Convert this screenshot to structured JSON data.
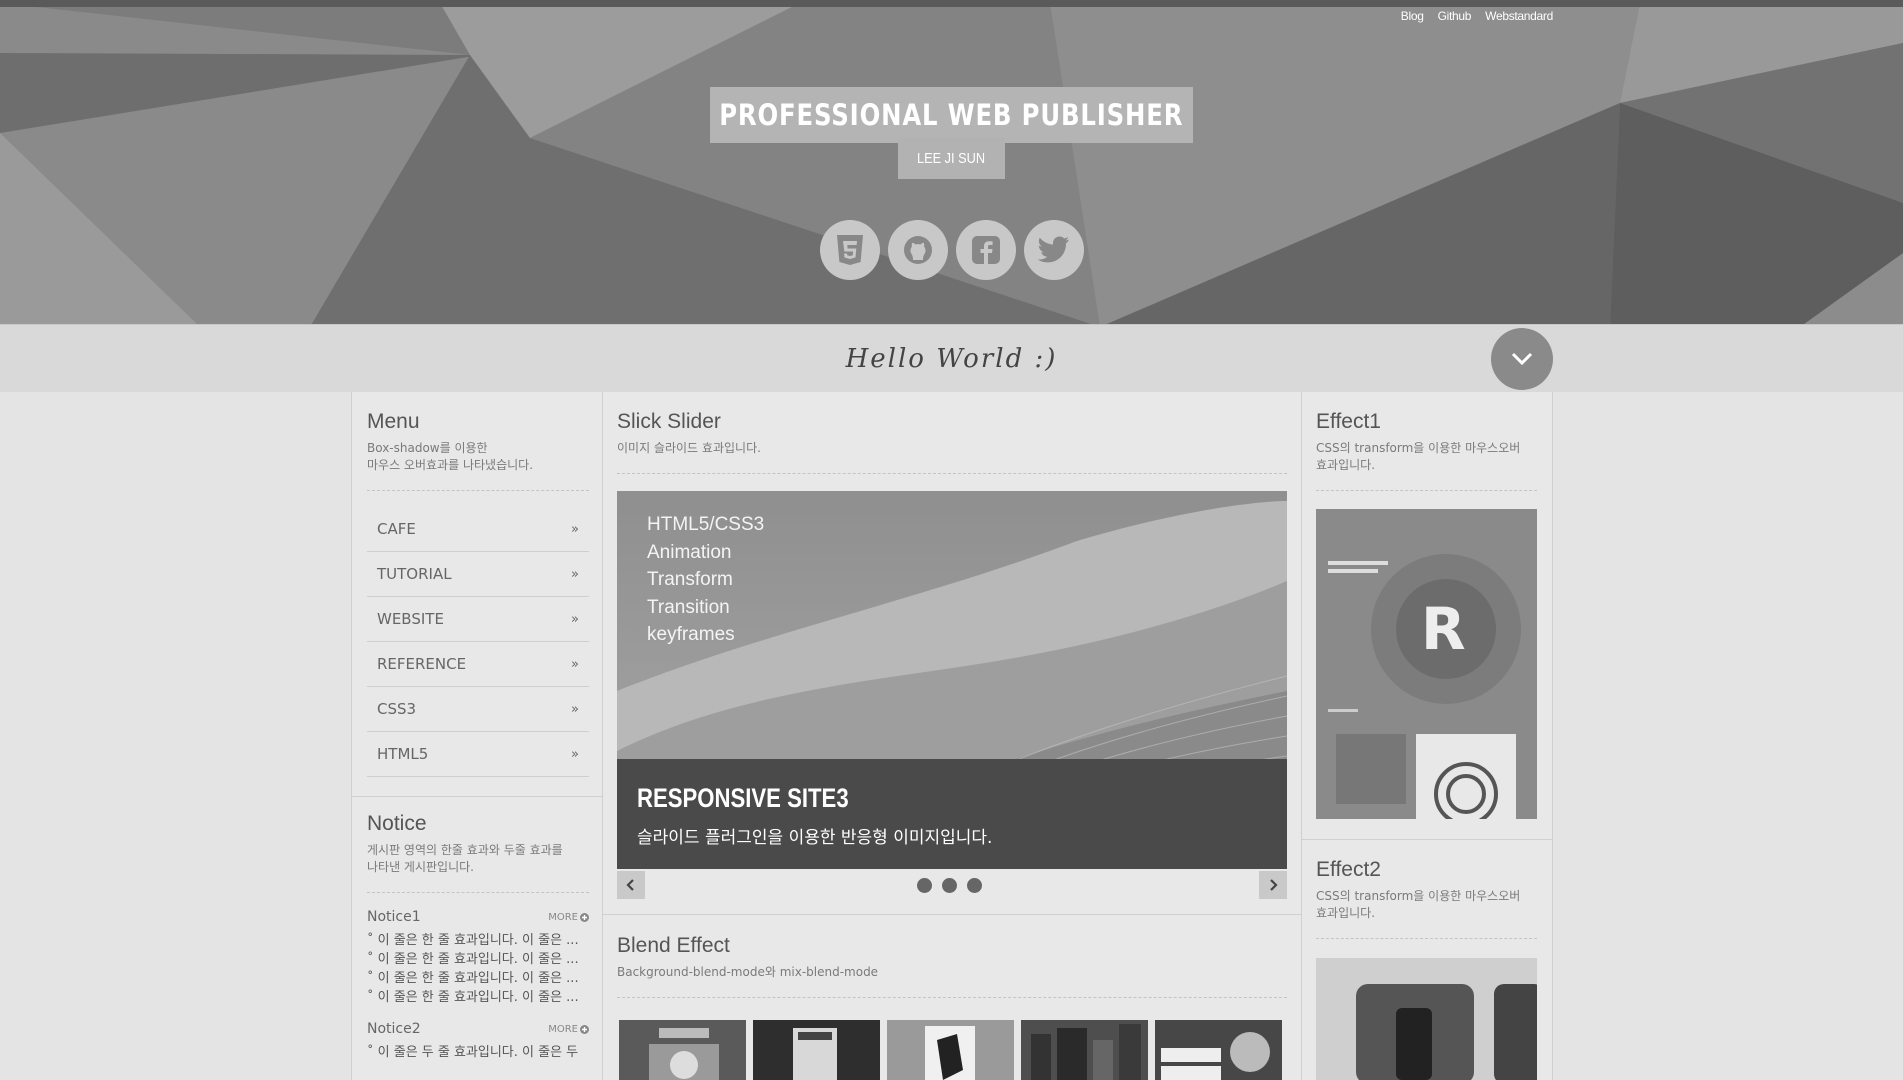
{
  "top_links": [
    "Blog",
    "Github",
    "Webstandard"
  ],
  "header": {
    "title": "PROFESSIONAL WEB PUBLISHER",
    "subtitle": "LEE JI SUN"
  },
  "socials": [
    {
      "name": "html5-icon"
    },
    {
      "name": "github-icon"
    },
    {
      "name": "facebook-icon"
    },
    {
      "name": "twitter-icon"
    }
  ],
  "hello": "Hello World :)",
  "menu": {
    "title": "Menu",
    "desc1": "Box-shadow를 이용한",
    "desc2": "마우스 오버효과를 나타냈습니다.",
    "items": [
      "CAFE",
      "TUTORIAL",
      "WEBSITE",
      "REFERENCE",
      "CSS3",
      "HTML5"
    ]
  },
  "notice": {
    "title": "Notice",
    "desc1": "게시판 영역의 한줄 효과와 두줄 효과를",
    "desc2": "나타낸 게시판입니다.",
    "more_label": "MORE",
    "n1": {
      "title": "Notice1",
      "items": [
        "이 줄은 한 줄 효과입니다. 이 줄은 ...",
        "이 줄은 한 줄 효과입니다. 이 줄은 ...",
        "이 줄은 한 줄 효과입니다. 이 줄은 ...",
        "이 줄은 한 줄 효과입니다. 이 줄은 ..."
      ]
    },
    "n2": {
      "title": "Notice2",
      "items": [
        "이 줄은 두 줄 효과입니다. 이 줄은 두"
      ]
    }
  },
  "slick": {
    "title": "Slick Slider",
    "desc": "이미지 슬라이드 효과입니다.",
    "lines": [
      "HTML5/CSS3",
      "Animation",
      "Transform",
      "Transition",
      "keyframes"
    ],
    "caption_title": "RESPONSIVE SITE3",
    "caption_desc": "슬라이드 플러그인을 이용한 반응형 이미지입니다."
  },
  "blend": {
    "title": "Blend Effect",
    "desc": "Background-blend-mode와 mix-blend-mode"
  },
  "effect1": {
    "title": "Effect1",
    "desc1": "CSS의 transform을 이용한 마우스오버",
    "desc2": "효과입니다."
  },
  "effect2": {
    "title": "Effect2",
    "desc1": "CSS의 transform을 이용한 마우스오버",
    "desc2": "효과입니다."
  }
}
